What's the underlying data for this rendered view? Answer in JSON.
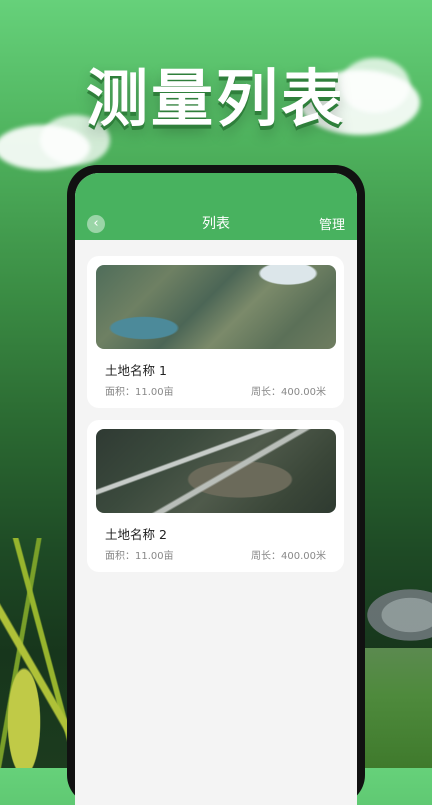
{
  "headline": "测量列表",
  "appbar": {
    "title": "列表",
    "back_icon": "chevron-left-icon",
    "manage_label": "管理"
  },
  "items": [
    {
      "name": "土地名称 1",
      "area": "面积：11.00亩",
      "perimeter": "周长：400.00米"
    },
    {
      "name": "土地名称 2",
      "area": "面积：11.00亩",
      "perimeter": "周长：400.00米"
    }
  ],
  "colors": {
    "accent": "#48b25f",
    "background": "#f4f4f4"
  }
}
